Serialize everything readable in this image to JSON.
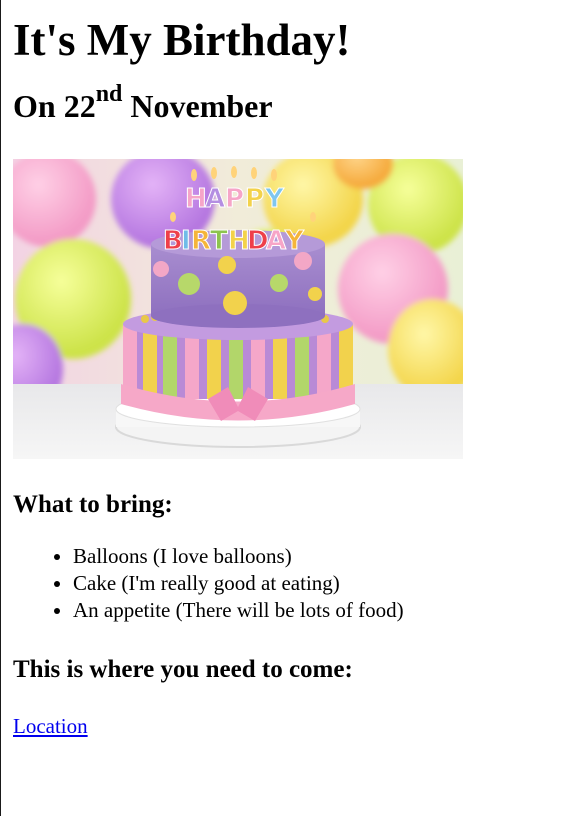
{
  "page": {
    "title": "It's My Birthday!",
    "date_prefix": "On 22",
    "date_suffix": "nd",
    "date_month": " November"
  },
  "image": {
    "description_icon": "birthday-cake-image",
    "banner_text": "HAPPY BIRTHDAY"
  },
  "bring": {
    "heading": "What to bring:",
    "items": [
      "Balloons (I love balloons)",
      "Cake (I'm really good at eating)",
      "An appetite (There will be lots of food)"
    ]
  },
  "where": {
    "heading": "This is where you need to come:",
    "link_label": "Location"
  },
  "colors": {
    "link": "#0000ee"
  }
}
